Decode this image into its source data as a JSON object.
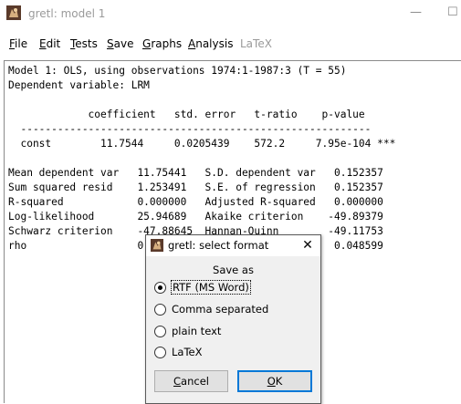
{
  "window": {
    "title": "gretl: model 1",
    "minimize_glyph": "—",
    "maximize_glyph": "☐"
  },
  "menubar": {
    "items": [
      {
        "label": "File",
        "mnemonic": "F",
        "rest": "ile"
      },
      {
        "label": "Edit",
        "mnemonic": "E",
        "rest": "dit"
      },
      {
        "label": "Tests",
        "mnemonic": "T",
        "rest": "ests"
      },
      {
        "label": "Save",
        "mnemonic": "S",
        "rest": "ave"
      },
      {
        "label": "Graphs",
        "mnemonic": "G",
        "rest": "raphs"
      },
      {
        "label": "Analysis",
        "mnemonic": "A",
        "rest": "nalysis"
      },
      {
        "label": "LaTeX",
        "mnemonic": "",
        "rest": "LaTeX"
      }
    ]
  },
  "output": {
    "lines": [
      "Model 1: OLS, using observations 1974:1-1987:3 (T = 55)",
      "Dependent variable: LRM",
      "",
      "             coefficient   std. error   t-ratio    p-value",
      "  ---------------------------------------------------------",
      "  const        11.7544     0.0205439    572.2     7.95e-104 ***",
      "",
      "Mean dependent var   11.75441   S.D. dependent var   0.152357",
      "Sum squared resid    1.253491   S.E. of regression   0.152357",
      "R-squared            0.000000   Adjusted R-squared   0.000000",
      "Log-likelihood       25.94689   Akaike criterion    -49.89379",
      "Schwarz criterion    -47.88645  Hannan-Quinn        -49.11753",
      "rho                  0.911961   Durbin-Watson        0.048599"
    ]
  },
  "dialog": {
    "title": "gretl: select format",
    "close_glyph": "✕",
    "save_as_label": "Save as",
    "options": [
      {
        "label": "RTF (MS Word)",
        "selected": true
      },
      {
        "label": "Comma separated",
        "selected": false
      },
      {
        "label": "plain text",
        "selected": false
      },
      {
        "label": "LaTeX",
        "selected": false
      }
    ],
    "cancel_label": "Cancel",
    "cancel_mnemonic": "C",
    "cancel_rest": "ancel",
    "ok_label": "OK",
    "ok_mnemonic": "O",
    "ok_rest": "K"
  }
}
